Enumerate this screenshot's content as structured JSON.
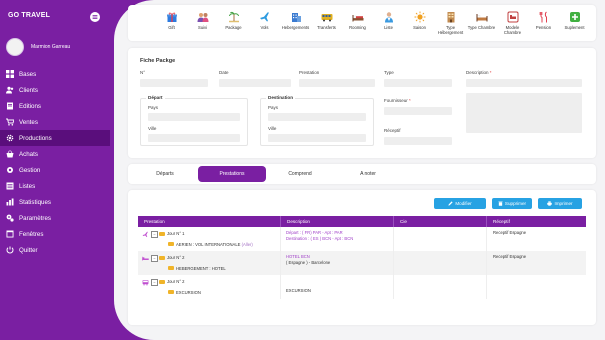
{
  "app": {
    "title": "GO TRAVEL"
  },
  "user": {
    "name": "Marmion Garreau"
  },
  "sidebar": {
    "items": [
      {
        "label": "Bases",
        "icon": "grid-icon",
        "active": false
      },
      {
        "label": "Clients",
        "icon": "users-icon",
        "active": false
      },
      {
        "label": "Editions",
        "icon": "book-icon",
        "active": false
      },
      {
        "label": "Ventes",
        "icon": "cart-icon",
        "active": false
      },
      {
        "label": "Productions",
        "icon": "gear-icon",
        "active": true
      },
      {
        "label": "Achats",
        "icon": "basket-icon",
        "active": false
      },
      {
        "label": "Gestion",
        "icon": "cog-icon",
        "active": false
      },
      {
        "label": "Listes",
        "icon": "list-icon",
        "active": false
      },
      {
        "label": "Statistiques",
        "icon": "chart-icon",
        "active": false
      },
      {
        "label": "Paramètres",
        "icon": "settings-icon",
        "active": false
      },
      {
        "label": "Fenêtres",
        "icon": "window-icon",
        "active": false
      },
      {
        "label": "Quitter",
        "icon": "exit-icon",
        "active": false
      }
    ]
  },
  "toolbar": {
    "items": [
      {
        "label": "Gift",
        "icon": "gift-icon",
        "color": "#2d7be0"
      },
      {
        "label": "Suivi",
        "icon": "people-icon",
        "color": "#7a4fb0"
      },
      {
        "label": "Package",
        "icon": "beach-icon",
        "color": "#e0a020"
      },
      {
        "label": "Vols",
        "icon": "plane-icon",
        "color": "#2d9be0"
      },
      {
        "label": "Hebergements",
        "icon": "building-icon",
        "color": "#3a7ad0"
      },
      {
        "label": "Transferts",
        "icon": "bus-icon",
        "color": "#e0b020"
      },
      {
        "label": "Rooming",
        "icon": "bed-icon",
        "color": "#d04040"
      },
      {
        "label": "Liste",
        "icon": "doctor-icon",
        "color": "#3a9ae0"
      },
      {
        "label": "Saison",
        "icon": "sun-icon",
        "color": "#f0a020"
      },
      {
        "label": "Type Hébergement",
        "icon": "hotel-type-icon",
        "color": "#c08a50"
      },
      {
        "label": "Type Chambre",
        "icon": "room-type-icon",
        "color": "#c07a40"
      },
      {
        "label": "Modele Chambre",
        "icon": "room-model-icon",
        "color": "#c04040"
      },
      {
        "label": "Pension",
        "icon": "utensils-icon",
        "color": "#e04050"
      },
      {
        "label": "Suplement",
        "icon": "plus-icon",
        "color": "#40b040"
      }
    ]
  },
  "fiche": {
    "title": "Fiche Packge",
    "labels": {
      "num": "N°",
      "date": "Date",
      "prestation": "Prestation",
      "type": "Type",
      "description": "Description",
      "required_star": "*",
      "depart": "Départ",
      "destination": "Destination",
      "pays": "Pays",
      "ville": "Ville",
      "fournisseur": "Fournisseur",
      "receptif": "Réceptif"
    }
  },
  "tabs": [
    {
      "label": "Départs",
      "active": false
    },
    {
      "label": "Prestations",
      "active": true
    },
    {
      "label": "Comprend",
      "active": false
    },
    {
      "label": "A noter",
      "active": false
    }
  ],
  "actions": {
    "modifier": "Modifier",
    "supprimer": "Supprimer",
    "imprimer": "Imprimer"
  },
  "table": {
    "columns": [
      "Prestation",
      "Description",
      "Cie",
      "Réceptif"
    ],
    "rows": [
      {
        "icon": "plane-icon",
        "icon_color": "#c050d0",
        "jour": "Jour N° 1",
        "service": "AERIEN : VOL INTERNATIONALE",
        "service_alt": "(Aller)",
        "desc_line1": "Départ : ( FR) PAR - Apt : PAR",
        "desc_line2": "Destination : ( ES ) BCN - Apt : BCN",
        "cie": "",
        "receptif": "Receptif Espagne"
      },
      {
        "icon": "bed-icon",
        "icon_color": "#c050d0",
        "jour": "Jour N° 2",
        "service": "HEBERGEMENT : HOTEL",
        "service_alt": "",
        "desc_line1": "HOTEL BCN",
        "desc_line2": "( Espagne ) - Barcelone",
        "cie": "",
        "receptif": "Receptif Espagne"
      },
      {
        "icon": "bus-icon",
        "icon_color": "#c050d0",
        "jour": "Jour N° 2",
        "service": "EXCURSION",
        "service_alt": "",
        "desc_line1": "EXCURSION",
        "desc_line2": "",
        "cie": "",
        "receptif": ""
      }
    ]
  }
}
